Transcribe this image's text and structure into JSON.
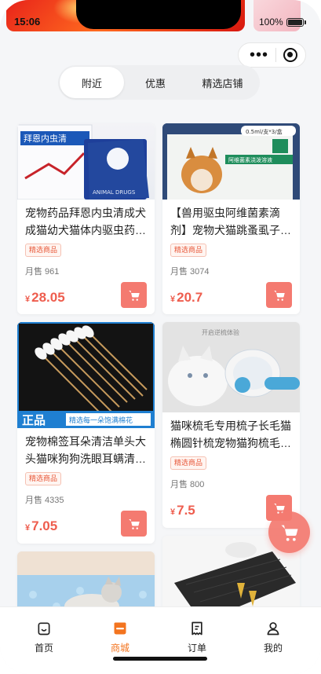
{
  "status_bar": {
    "time": "15:06",
    "battery": "100%"
  },
  "capsule": {
    "more_icon": "more-dots-icon",
    "close_icon": "target-icon"
  },
  "tabs": [
    {
      "label": "附近",
      "active": true
    },
    {
      "label": "优惠",
      "active": false
    },
    {
      "label": "精选店铺",
      "active": false
    }
  ],
  "products": [
    {
      "title": "宠物药品拜恩内虫清成犬成猫幼犬猫体内驱虫药…",
      "tag": "精选商品",
      "sales": "月售 961",
      "currency": "¥",
      "price": "28.05",
      "image_text": [
        "拜恩内虫清",
        "ANIMAL DRUGS"
      ]
    },
    {
      "title": "【兽用驱虫阿维菌素滴剂】宠物犬猫跳蚤虱子…",
      "tag": "精选商品",
      "sales": "月售 3074",
      "currency": "¥",
      "price": "20.7",
      "image_text": [
        "0.5ml/支*3/盒",
        "阿维菌素浇泼溶液"
      ]
    },
    {
      "title": "宠物棉签耳朵清洁单头大头猫咪狗狗洗眼耳螨清…",
      "tag": "精选商品",
      "sales": "月售 4335",
      "currency": "¥",
      "price": "7.05",
      "image_text": [
        "正品",
        "精选每一朵饱满棉花"
      ]
    },
    {
      "title": "猫咪梳毛专用梳子长毛猫椭圆针梳宠物猫狗梳毛…",
      "tag": "精选商品",
      "sales": "月售 800",
      "currency": "¥",
      "price": "7.5",
      "image_text": [
        "开启逆梳体验"
      ]
    }
  ],
  "bottom_nav": [
    {
      "label": "首页",
      "icon": "home-icon",
      "active": false
    },
    {
      "label": "商城",
      "icon": "shop-icon",
      "active": true
    },
    {
      "label": "订单",
      "icon": "order-icon",
      "active": false
    },
    {
      "label": "我的",
      "icon": "user-icon",
      "active": false
    }
  ],
  "colors": {
    "accent": "#f47a70",
    "price": "#ee5d4e",
    "nav_active": "#f3741f"
  }
}
